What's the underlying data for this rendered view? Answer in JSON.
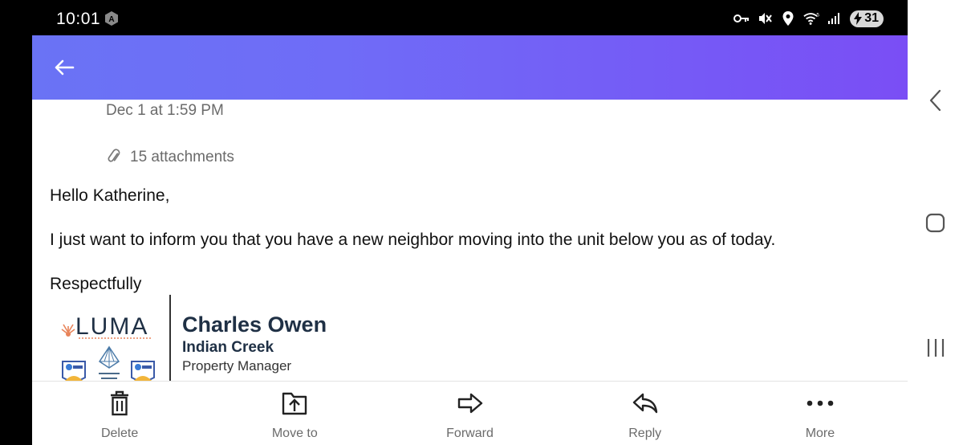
{
  "status_bar": {
    "time": "10:01",
    "battery": "31",
    "icons": [
      "key-icon",
      "mute-icon",
      "location-icon",
      "wifi-icon",
      "signal-icon"
    ]
  },
  "header": {
    "back_icon": "arrow-left-icon",
    "gradient_start": "#6a73f5",
    "gradient_end": "#7a4ef5"
  },
  "email": {
    "date": "Dec 1 at 1:59 PM",
    "attachments": "15 attachments",
    "greeting": "Hello Katherine,",
    "message": "I just want to inform you that you have a new neighbor moving into the unit below you as of today.",
    "signoff": "Respectfully"
  },
  "signature": {
    "logo_text": "LUMA",
    "name": "Charles Owen",
    "company": "Indian Creek",
    "title": "Property Manager"
  },
  "toolbar": {
    "items": [
      {
        "label": "Delete",
        "icon": "trash-icon"
      },
      {
        "label": "Move to",
        "icon": "move-to-icon"
      },
      {
        "label": "Forward",
        "icon": "forward-icon"
      },
      {
        "label": "Reply",
        "icon": "reply-icon"
      },
      {
        "label": "More",
        "icon": "more-icon"
      }
    ]
  },
  "system_nav": [
    "nav-back-icon",
    "nav-home-icon",
    "nav-recents-icon"
  ]
}
